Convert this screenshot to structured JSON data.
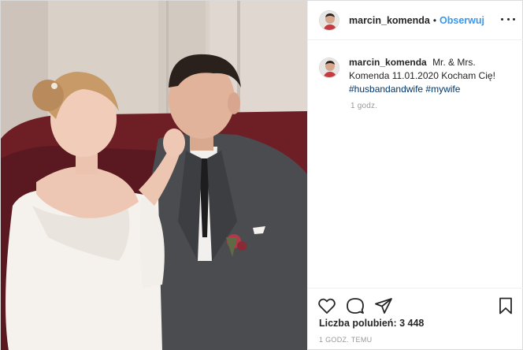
{
  "post": {
    "author": {
      "username": "marcin_komenda",
      "follow_label": "Obserwuj",
      "separator": "•"
    },
    "caption": {
      "username": "marcin_komenda",
      "text": "Mr. & Mrs. Komenda 11.01.2020 Kocham Cię!",
      "hashtags": [
        "#husbandandwife",
        "#mywife"
      ],
      "time": "1 godz."
    },
    "likes_label": "Liczba polubień: 3 448",
    "timestamp": "1 GODZ. TEMU",
    "icons": [
      "heart-icon",
      "comment-icon",
      "share-icon",
      "bookmark-icon",
      "more-options-icon"
    ]
  },
  "colors": {
    "link": "#3897f0",
    "hashtag": "#003569",
    "muted": "#999999",
    "border": "#dbdbdb"
  }
}
